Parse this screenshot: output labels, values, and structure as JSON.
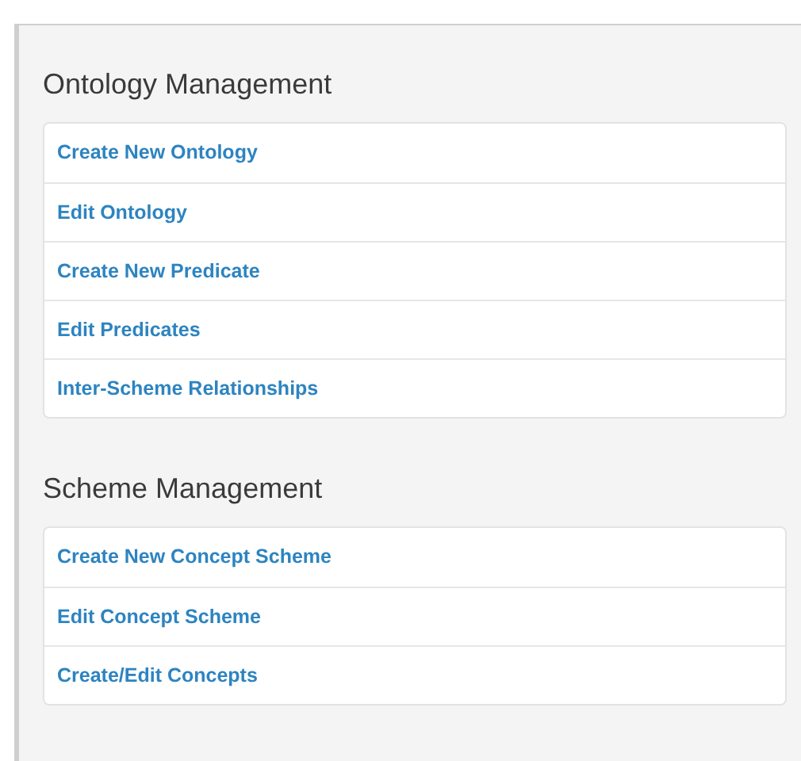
{
  "sections": [
    {
      "title": "Ontology Management",
      "links": [
        {
          "label": "Create New Ontology"
        },
        {
          "label": "Edit Ontology"
        },
        {
          "label": "Create New Predicate"
        },
        {
          "label": "Edit Predicates"
        },
        {
          "label": "Inter-Scheme Relationships"
        }
      ]
    },
    {
      "title": "Scheme Management",
      "links": [
        {
          "label": "Create New Concept Scheme"
        },
        {
          "label": "Edit Concept Scheme"
        },
        {
          "label": "Create/Edit Concepts"
        }
      ]
    }
  ]
}
